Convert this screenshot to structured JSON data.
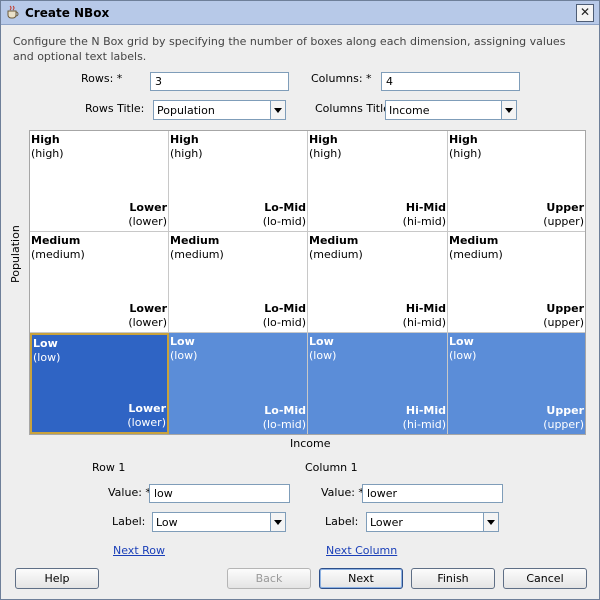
{
  "window": {
    "title": "Create NBox",
    "close_glyph": "✕"
  },
  "description": "Configure the N Box grid by specifying the number of boxes along each dimension, assigning values and optional text labels.",
  "form": {
    "rows_label": "Rows: *",
    "rows_value": "3",
    "columns_label": "Columns: *",
    "columns_value": "4",
    "rows_title_label": "Rows Title:",
    "rows_title_value": "Population",
    "columns_title_label": "Columns Title:",
    "columns_title_value": "Income"
  },
  "grid": {
    "row_axis_title": "Population",
    "column_axis_title": "Income",
    "rows": [
      {
        "label": "High",
        "value": "(high)"
      },
      {
        "label": "Medium",
        "value": "(medium)"
      },
      {
        "label": "Low",
        "value": "(low)"
      }
    ],
    "columns": [
      {
        "label": "Lower",
        "value": "(lower)"
      },
      {
        "label": "Lo-Mid",
        "value": "(lo-mid)"
      },
      {
        "label": "Hi-Mid",
        "value": "(hi-mid)"
      },
      {
        "label": "Upper",
        "value": "(upper)"
      }
    ],
    "highlighted_row": 2,
    "selected_cell": {
      "row": 2,
      "column": 0
    },
    "colors": {
      "highlight": "#5b8dd8",
      "selected": "#2f64c4",
      "selected_border": "#c8a23d"
    }
  },
  "row_editor": {
    "heading": "Row 1",
    "value_label": "Value: *",
    "value": "low",
    "label_label": "Label:",
    "label_value": "Low",
    "next_link": "Next Row"
  },
  "column_editor": {
    "heading": "Column 1",
    "value_label": "Value: *",
    "value": "lower",
    "label_label": "Label:",
    "label_value": "Lower",
    "next_link": "Next Column"
  },
  "buttons": {
    "help": "Help",
    "back": "Back",
    "next": "Next",
    "finish": "Finish",
    "cancel": "Cancel"
  }
}
